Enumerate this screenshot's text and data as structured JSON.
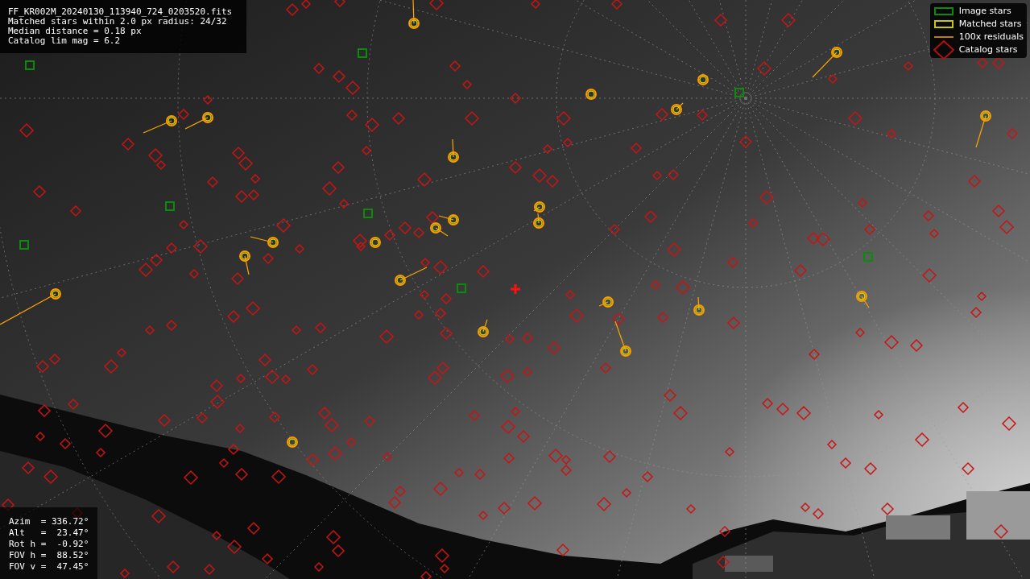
{
  "info_lines": [
    "FF_KR002M_20240130_113940_724_0203520.fits",
    "Matched stars within 2.0 px radius: 24/32",
    "Median distance = 0.18 px",
    "Catalog lim mag = 6.2"
  ],
  "legend": [
    {
      "label": "Image stars"
    },
    {
      "kind": "matched",
      "label": "Matched stars"
    },
    {
      "kind": "residual",
      "label": "100x residuals"
    },
    {
      "kind": "catalog",
      "label": "Catalog stars"
    }
  ],
  "pointing": [
    "Azim  = 336.72°",
    "Alt   =  23.47°",
    "Rot h =  -0.92°",
    "FOV h =  88.52°",
    "FOV v =  47.45°"
  ]
}
